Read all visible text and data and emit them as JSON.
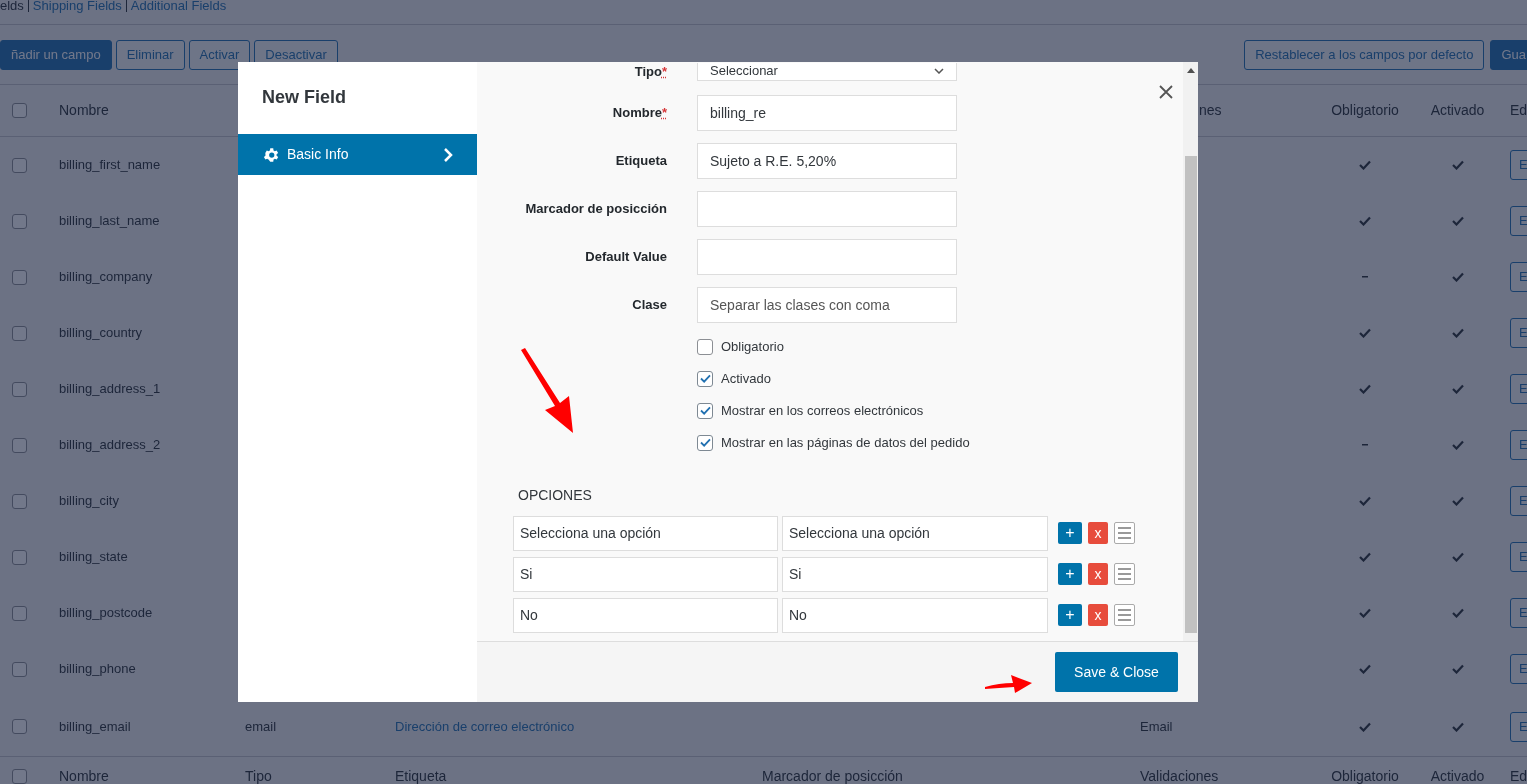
{
  "section_tabs": [
    {
      "label": "elds",
      "selected": true
    },
    {
      "label": "Shipping Fields",
      "selected": false
    },
    {
      "label": "Additional Fields",
      "selected": false
    }
  ],
  "toolbar": {
    "left": [
      {
        "label": "ñadir un campo",
        "kind": "primary"
      },
      {
        "label": "Eliminar",
        "kind": "secondary"
      },
      {
        "label": "Activar",
        "kind": "secondary"
      },
      {
        "label": "Desactivar",
        "kind": "secondary"
      }
    ],
    "right": [
      {
        "label": "Restablecer a los campos por defecto",
        "kind": "secondary"
      },
      {
        "label": "Gua",
        "kind": "primary"
      }
    ]
  },
  "table": {
    "header": {
      "checked": false,
      "name": "Nombre",
      "validations": "nes",
      "required": "Obligatorio",
      "enabled": "Activado",
      "edit": "Ed"
    },
    "rows": [
      {
        "checked": false,
        "name": "billing_first_name",
        "required": true,
        "enabled": true,
        "edit": "E"
      },
      {
        "checked": false,
        "name": "billing_last_name",
        "required": true,
        "enabled": true,
        "edit": "E"
      },
      {
        "checked": false,
        "name": "billing_company",
        "required": false,
        "enabled": true,
        "edit": "E"
      },
      {
        "checked": false,
        "name": "billing_country",
        "required": true,
        "enabled": true,
        "edit": "E"
      },
      {
        "checked": false,
        "name": "billing_address_1",
        "required": true,
        "enabled": true,
        "edit": "E"
      },
      {
        "checked": false,
        "name": "billing_address_2",
        "required": false,
        "enabled": true,
        "edit": "E"
      },
      {
        "checked": false,
        "name": "billing_city",
        "required": true,
        "enabled": true,
        "edit": "E"
      },
      {
        "checked": false,
        "name": "billing_state",
        "required": true,
        "enabled": true,
        "edit": "E"
      },
      {
        "checked": false,
        "name": "billing_postcode",
        "required": true,
        "enabled": true,
        "edit": "E"
      },
      {
        "checked": false,
        "name": "billing_phone",
        "required": true,
        "enabled": true,
        "edit": "E"
      },
      {
        "checked": false,
        "name": "billing_email",
        "type": "email",
        "label": "Dirección de correo electrónico",
        "validations": "Email",
        "required": true,
        "enabled": true,
        "edit": "E"
      }
    ],
    "footer": {
      "checked": false,
      "name": "Nombre",
      "type": "Tipo",
      "label": "Etiqueta",
      "placeholder": "Marcador de posicción",
      "validations": "Validaciones",
      "required": "Obligatorio",
      "enabled": "Activado",
      "edit": "Ed"
    }
  },
  "modal": {
    "title": "New Field",
    "sidebar": [
      {
        "label": "Basic Info",
        "selected": true
      }
    ],
    "fields": [
      {
        "label": "Tipo",
        "mark": "*",
        "kind": "select",
        "value": "Seleccionar"
      },
      {
        "label": "Nombre",
        "mark": "*",
        "kind": "text",
        "value": "billing_re"
      },
      {
        "label": "Etiqueta",
        "kind": "text",
        "value": "Sujeto a R.E. 5,20%"
      },
      {
        "label": "Marcador de posicción",
        "kind": "text"
      },
      {
        "label": "Default Value",
        "kind": "text"
      },
      {
        "label": "Clase",
        "kind": "text",
        "placeholder": "Separar las clases con coma"
      }
    ],
    "checkboxes": [
      {
        "label": "Obligatorio",
        "checked": false
      },
      {
        "label": "Activado",
        "checked": true
      },
      {
        "label": "Mostrar en los correos electrónicos",
        "checked": true
      },
      {
        "label": "Mostrar en las páginas de datos del pedido",
        "checked": true
      }
    ],
    "options_title": "OPCIONES",
    "options": [
      {
        "key": "Selecciona una opción",
        "text": "Selecciona una opción",
        "add": "+",
        "remove": "x"
      },
      {
        "key": "Si",
        "text": "Si",
        "add": "+",
        "remove": "x"
      },
      {
        "key": "No",
        "text": "No",
        "add": "+",
        "remove": "x"
      }
    ],
    "save_button": "Save & Close"
  }
}
